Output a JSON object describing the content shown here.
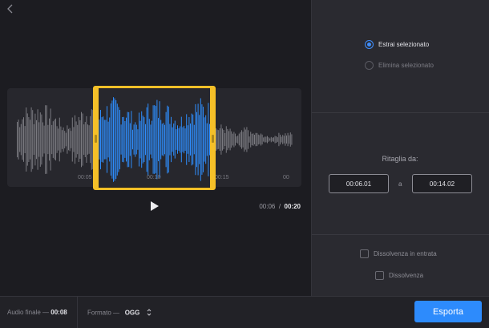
{
  "toolbar": {
    "back_icon": "chevron-left-icon"
  },
  "waveform": {
    "ticks": [
      "00:05",
      "00:10",
      "00:15",
      "00"
    ],
    "colors": {
      "waveform": "#7a7a80",
      "selected": "#2e8cfb",
      "selection_frame": "#f5c028"
    }
  },
  "player": {
    "current": "00:06",
    "separator": "/",
    "total": "00:20"
  },
  "options": {
    "extract_label": "Estrai selezionato",
    "delete_label": "Elimina selezionato",
    "selected": "extract"
  },
  "trim": {
    "label": "Ritaglia da:",
    "start": "00:06.01",
    "between": "a",
    "end": "00:14.02"
  },
  "fades": {
    "fade_in_label": "Dissolvenza in entrata",
    "fade_out_label": "Dissolvenza"
  },
  "bottom": {
    "final_audio_label": "Audio finale —",
    "final_audio_value": "00:08",
    "format_label": "Formato —",
    "format_value": "OGG",
    "export_label": "Esporta"
  }
}
